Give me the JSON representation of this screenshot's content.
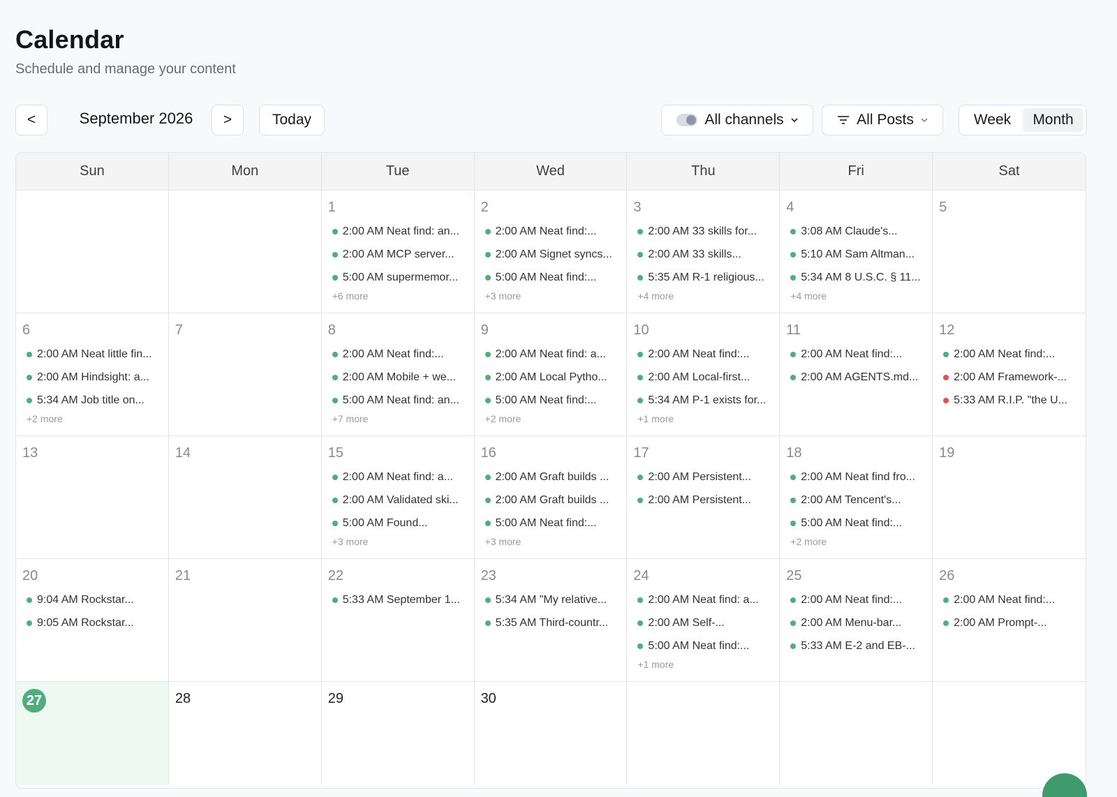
{
  "header": {
    "title": "Calendar",
    "subtitle": "Schedule and manage your content"
  },
  "toolbar": {
    "prev_label": "<",
    "next_label": ">",
    "month_label": "September 2026",
    "today_label": "Today",
    "channels_label": "All channels",
    "posts_label": "All Posts",
    "week_label": "Week",
    "month_view_label": "Month",
    "active_view": "Month"
  },
  "colors": {
    "accent": "#4fae7d",
    "event_dot": "#4fae7d",
    "event_dot_alert": "#d9534f",
    "today_bg": "#eef9f2"
  },
  "weekdays": [
    "Sun",
    "Mon",
    "Tue",
    "Wed",
    "Thu",
    "Fri",
    "Sat"
  ],
  "days": [
    {
      "day": ""
    },
    {
      "day": ""
    },
    {
      "day": "1",
      "events": [
        {
          "t": "2:00 AM Neat find: an..."
        },
        {
          "t": "2:00 AM MCP server..."
        },
        {
          "t": "5:00 AM supermemor..."
        }
      ],
      "more": "+6 more"
    },
    {
      "day": "2",
      "events": [
        {
          "t": "2:00 AM Neat find:..."
        },
        {
          "t": "2:00 AM Signet syncs..."
        },
        {
          "t": "5:00 AM Neat find:..."
        }
      ],
      "more": "+3 more"
    },
    {
      "day": "3",
      "events": [
        {
          "t": "2:00 AM 33 skills for..."
        },
        {
          "t": "2:00 AM 33 skills..."
        },
        {
          "t": "5:35 AM R-1 religious..."
        }
      ],
      "more": "+4 more"
    },
    {
      "day": "4",
      "events": [
        {
          "t": "3:08 AM Claude's..."
        },
        {
          "t": "5:10 AM Sam Altman..."
        },
        {
          "t": "5:34 AM 8 U.S.C. § 11..."
        }
      ],
      "more": "+4 more"
    },
    {
      "day": "5"
    },
    {
      "day": "6",
      "events": [
        {
          "t": "2:00 AM Neat little fin..."
        },
        {
          "t": "2:00 AM Hindsight: a..."
        },
        {
          "t": "5:34 AM Job title on..."
        }
      ],
      "more": "+2 more"
    },
    {
      "day": "7"
    },
    {
      "day": "8",
      "events": [
        {
          "t": "2:00 AM Neat find:..."
        },
        {
          "t": "2:00 AM Mobile + we..."
        },
        {
          "t": "5:00 AM Neat find: an..."
        }
      ],
      "more": "+7 more"
    },
    {
      "day": "9",
      "events": [
        {
          "t": "2:00 AM Neat find: a..."
        },
        {
          "t": "2:00 AM Local Pytho..."
        },
        {
          "t": "5:00 AM Neat find:..."
        }
      ],
      "more": "+2 more"
    },
    {
      "day": "10",
      "events": [
        {
          "t": "2:00 AM Neat find:..."
        },
        {
          "t": "2:00 AM Local-first..."
        },
        {
          "t": "5:34 AM P-1 exists for..."
        }
      ],
      "more": "+1 more"
    },
    {
      "day": "11",
      "events": [
        {
          "t": "2:00 AM Neat find:..."
        },
        {
          "t": "2:00 AM AGENTS.md..."
        }
      ]
    },
    {
      "day": "12",
      "events": [
        {
          "t": "2:00 AM Neat find:..."
        },
        {
          "t": "2:00 AM Framework-...",
          "alert": true
        },
        {
          "t": "5:33 AM R.I.P. \"the U...",
          "alert": true
        }
      ]
    },
    {
      "day": "13"
    },
    {
      "day": "14"
    },
    {
      "day": "15",
      "events": [
        {
          "t": "2:00 AM Neat find: a..."
        },
        {
          "t": "2:00 AM Validated ski..."
        },
        {
          "t": "5:00 AM Found..."
        }
      ],
      "more": "+3 more"
    },
    {
      "day": "16",
      "events": [
        {
          "t": "2:00 AM Graft builds ..."
        },
        {
          "t": "2:00 AM Graft builds ..."
        },
        {
          "t": "5:00 AM Neat find:..."
        }
      ],
      "more": "+3 more"
    },
    {
      "day": "17",
      "events": [
        {
          "t": "2:00 AM Persistent..."
        },
        {
          "t": "2:00 AM Persistent..."
        }
      ]
    },
    {
      "day": "18",
      "events": [
        {
          "t": "2:00 AM Neat find fro..."
        },
        {
          "t": "2:00 AM Tencent's..."
        },
        {
          "t": "5:00 AM Neat find:..."
        }
      ],
      "more": "+2 more"
    },
    {
      "day": "19"
    },
    {
      "day": "20",
      "events": [
        {
          "t": "9:04 AM Rockstar..."
        },
        {
          "t": "9:05 AM Rockstar..."
        }
      ]
    },
    {
      "day": "21"
    },
    {
      "day": "22",
      "events": [
        {
          "t": "5:33 AM September 1..."
        }
      ]
    },
    {
      "day": "23",
      "events": [
        {
          "t": "5:34 AM \"My relative..."
        },
        {
          "t": "5:35 AM Third-countr..."
        }
      ]
    },
    {
      "day": "24",
      "events": [
        {
          "t": "2:00 AM Neat find: a..."
        },
        {
          "t": "2:00 AM Self-..."
        },
        {
          "t": "5:00 AM Neat find:..."
        }
      ],
      "more": "+1 more"
    },
    {
      "day": "25",
      "events": [
        {
          "t": "2:00 AM Neat find:..."
        },
        {
          "t": "2:00 AM Menu-bar..."
        },
        {
          "t": "5:33 AM E-2 and EB-..."
        }
      ]
    },
    {
      "day": "26",
      "events": [
        {
          "t": "2:00 AM Neat find:..."
        },
        {
          "t": "2:00 AM Prompt-..."
        }
      ]
    },
    {
      "day": "27",
      "today": true
    },
    {
      "day": "28",
      "current_month": true
    },
    {
      "day": "29",
      "current_month": true
    },
    {
      "day": "30",
      "current_month": true
    },
    {
      "day": ""
    },
    {
      "day": ""
    },
    {
      "day": ""
    }
  ]
}
